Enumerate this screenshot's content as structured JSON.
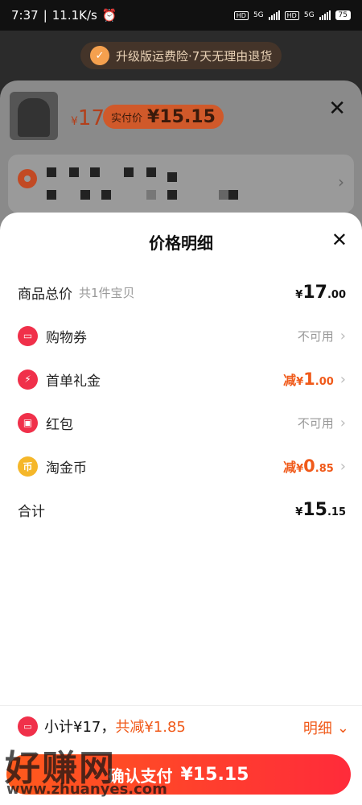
{
  "status_bar": {
    "time": "7:37",
    "speed": "11.1K/s",
    "network_1": "5G",
    "network_2": "5G",
    "hd_label": "HD",
    "battery": "75"
  },
  "background": {
    "banner_text": "升级版运费险·7天无理由退货",
    "product_price_symbol": "¥",
    "product_price": "17",
    "actual_price_label": "实付价",
    "actual_price": "¥15.15"
  },
  "sheet": {
    "title": "价格明细",
    "rows": {
      "total": {
        "label": "商品总价",
        "sub": "共1件宝贝",
        "currency": "¥",
        "value_big": "17",
        "value_small": ".00"
      },
      "coupon": {
        "label": "购物券",
        "status": "不可用"
      },
      "first_gift": {
        "label": "首单礼金",
        "prefix": "减",
        "currency": "¥",
        "value_big": "1",
        "value_small": ".00"
      },
      "red_packet": {
        "label": "红包",
        "status": "不可用"
      },
      "gold_coin": {
        "label": "淘金币",
        "prefix": "减",
        "currency": "¥",
        "value_big": "0",
        "value_small": ".85"
      },
      "sum": {
        "label": "合计",
        "currency": "¥",
        "value_big": "15",
        "value_small": ".15"
      }
    }
  },
  "bottom": {
    "subtotal_text": "小计¥17，",
    "saved_text": "共减¥1.85",
    "detail_label": "明细",
    "pay_label": "确认支付",
    "pay_amount": "¥15.15"
  },
  "watermark": {
    "text": "好赚网",
    "url": "www.zhuanyes.com"
  },
  "colors": {
    "accent": "#f05a1a",
    "pay_start": "#ff5a1c",
    "pay_end": "#ff2b3a",
    "coupon_icon": "#f0304a",
    "coin_icon": "#f5b72a"
  }
}
